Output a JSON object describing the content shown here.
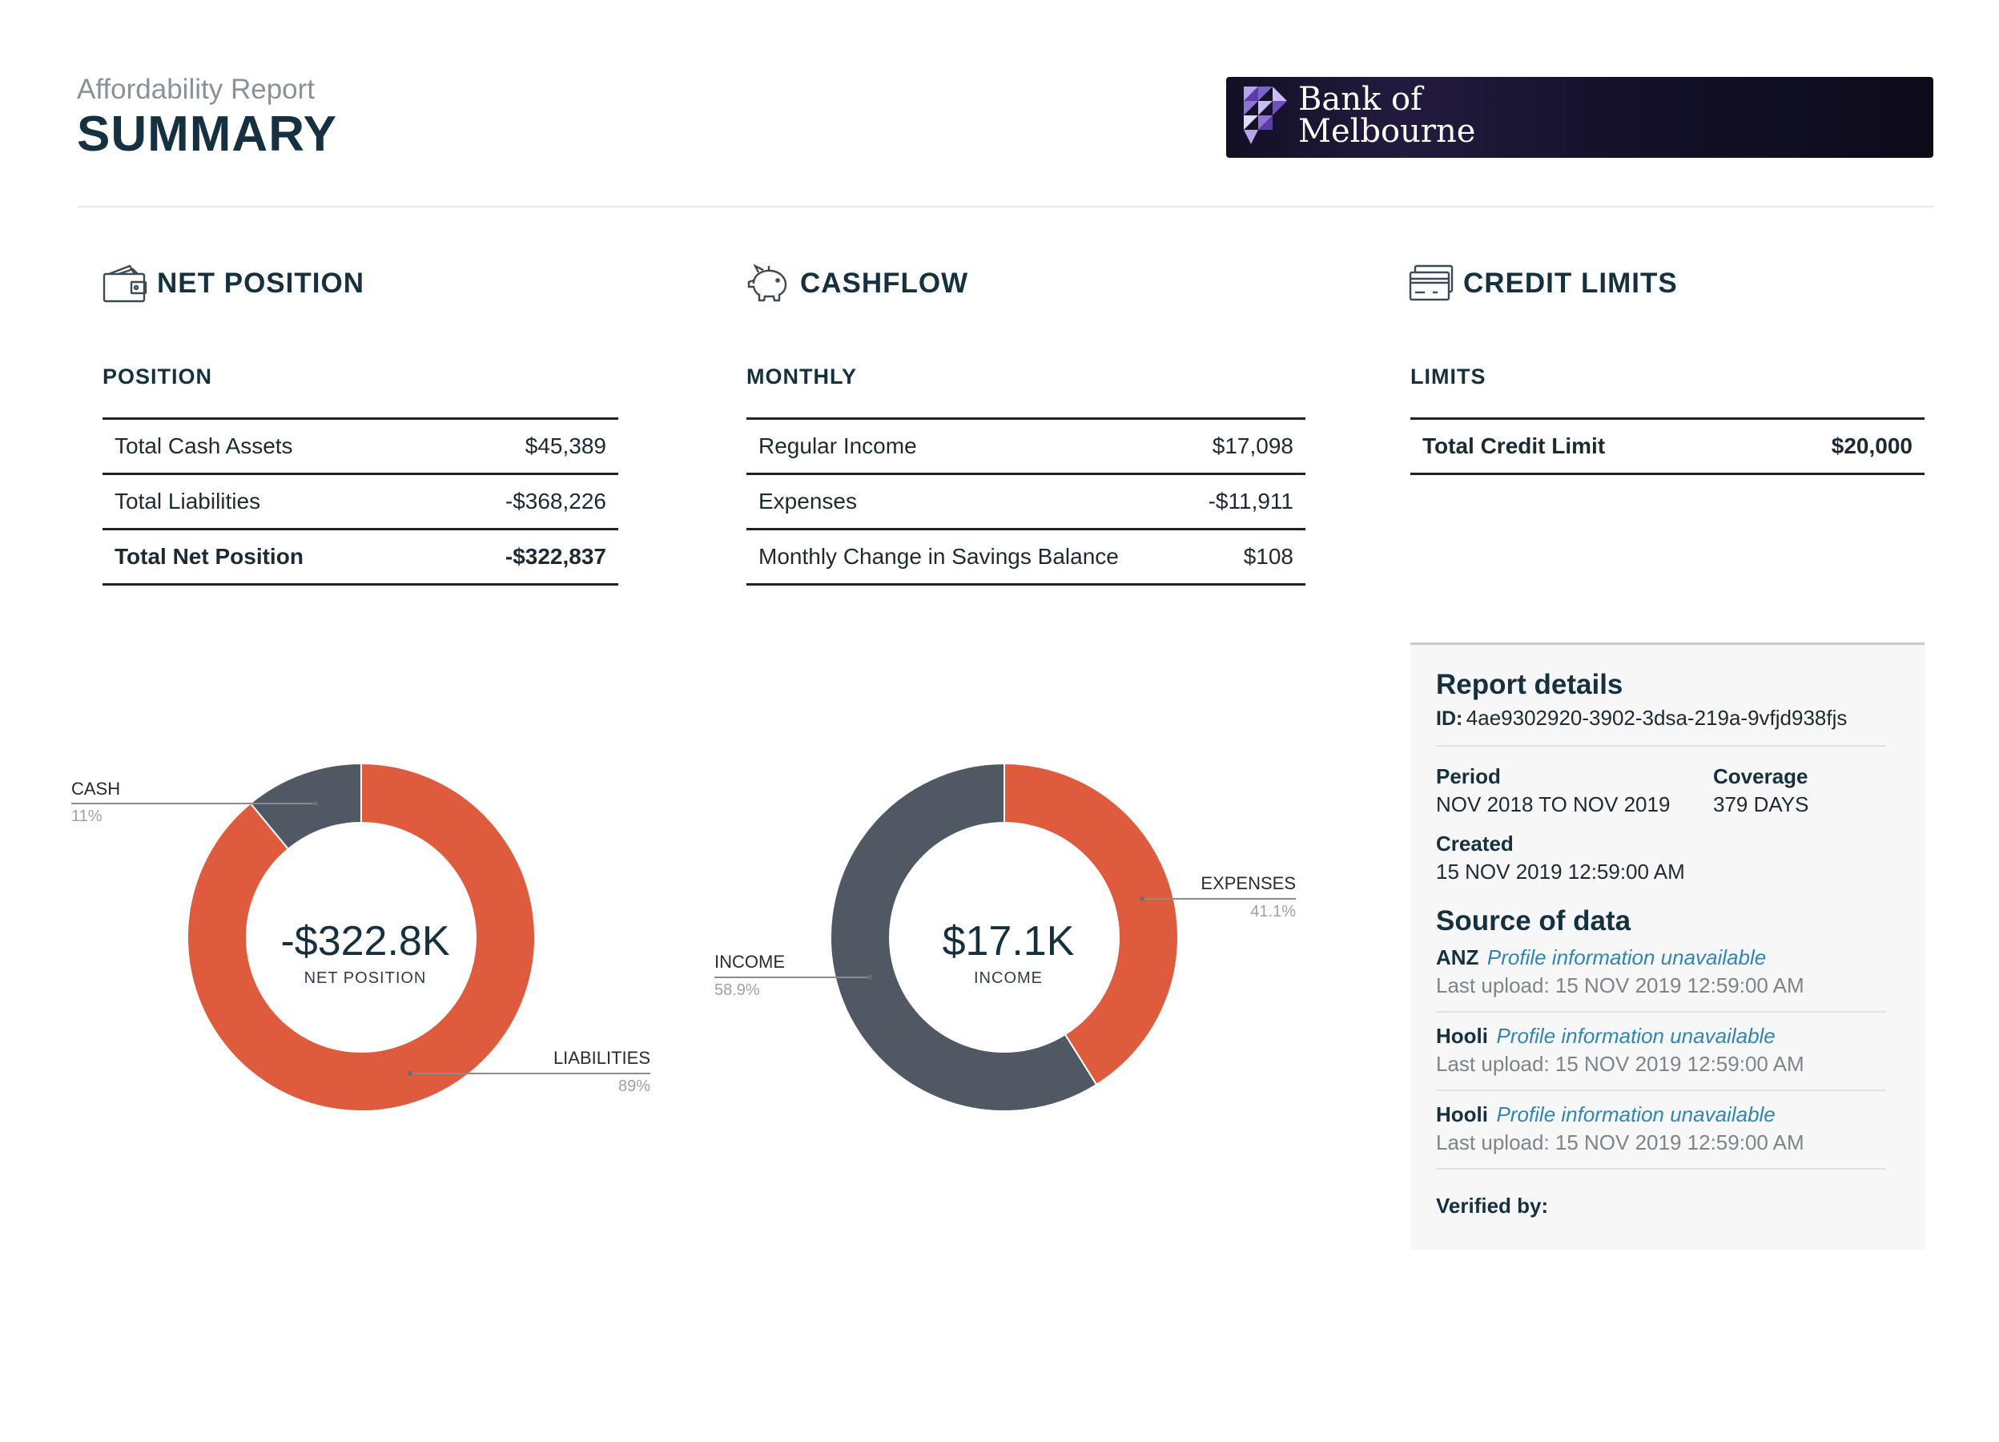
{
  "header": {
    "subtitle": "Affordability Report",
    "title": "SUMMARY",
    "brand_name_line1": "Bank of",
    "brand_name_line2": "Melbourne"
  },
  "net_position": {
    "heading": "NET POSITION",
    "icon": "wallet-icon",
    "subheading": "POSITION",
    "rows": [
      {
        "label": "Total Cash Assets",
        "value": "$45,389"
      },
      {
        "label": "Total Liabilities",
        "value": "-$368,226"
      },
      {
        "label": "Total Net Position",
        "value": "-$322,837"
      }
    ]
  },
  "cashflow": {
    "heading": "CASHFLOW",
    "icon": "piggy-bank-icon",
    "subheading": "MONTHLY",
    "rows": [
      {
        "label": "Regular Income",
        "value": "$17,098"
      },
      {
        "label": "Expenses",
        "value": "-$11,911"
      },
      {
        "label": "Monthly Change in Savings Balance",
        "value": "$108"
      }
    ]
  },
  "credit_limits": {
    "heading": "CREDIT LIMITS",
    "icon": "credit-card-icon",
    "subheading": "LIMITS",
    "rows": [
      {
        "label": "Total Credit Limit",
        "value": "$20,000"
      }
    ]
  },
  "chart_data": [
    {
      "type": "pie",
      "donut": true,
      "center_value": "-$322.8K",
      "center_caption": "NET POSITION",
      "slices": [
        {
          "label": "CASH",
          "percent_label": "11%",
          "value": 11,
          "color": "#505863"
        },
        {
          "label": "LIABILITIES",
          "percent_label": "89%",
          "value": 89,
          "color": "#df5b3d"
        }
      ]
    },
    {
      "type": "pie",
      "donut": true,
      "center_value": "$17.1K",
      "center_caption": "INCOME",
      "slices": [
        {
          "label": "EXPENSES",
          "percent_label": "41.1%",
          "value": 41.1,
          "color": "#df5b3d"
        },
        {
          "label": "INCOME",
          "percent_label": "58.9%",
          "value": 58.9,
          "color": "#505863"
        }
      ]
    }
  ],
  "report_details": {
    "title": "Report details",
    "id_label": "ID:",
    "id_value": "4ae9302920-3902-3dsa-219a-9vfjd938fjs",
    "period_label": "Period",
    "period_value": "NOV 2018 TO NOV 2019",
    "coverage_label": "Coverage",
    "coverage_value": "379 DAYS",
    "created_label": "Created",
    "created_value": "15 NOV 2019 12:59:00 AM",
    "source_title": "Source of data",
    "sources": [
      {
        "name": "ANZ",
        "note": "Profile information unavailable",
        "upload": "Last upload: 15 NOV 2019 12:59:00 AM"
      },
      {
        "name": "Hooli",
        "note": "Profile information unavailable",
        "upload": "Last upload: 15 NOV 2019 12:59:00 AM"
      },
      {
        "name": "Hooli",
        "note": "Profile information unavailable",
        "upload": "Last upload: 15 NOV 2019 12:59:00 AM"
      }
    ],
    "verified_label": "Verified by:"
  },
  "colors": {
    "accent_orange": "#df5b3d",
    "slate": "#505863",
    "heading_navy": "#15303f",
    "link_blue": "#2f86b4"
  }
}
